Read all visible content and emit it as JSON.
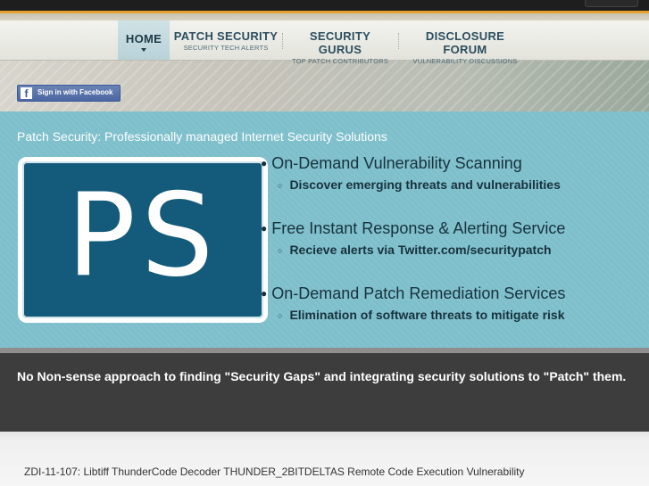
{
  "nav": {
    "home": {
      "label": "HOME"
    },
    "items": [
      {
        "label": "PATCH SECURITY",
        "sub": "SECURITY TECH ALERTS"
      },
      {
        "label": "SECURITY GURUS",
        "sub": "TOP PATCH CONTRIBUTORS"
      },
      {
        "label": "DISCLOSURE FORUM",
        "sub": "VULNERABILITY DISCUSSIONS"
      }
    ]
  },
  "facebook": {
    "label": "Sign in with Facebook",
    "icon": "facebook-f-icon"
  },
  "hero": {
    "title": "Patch Security: Professionally managed Internet Security Solutions",
    "logo_text": "PS",
    "features": [
      {
        "title": "On-Demand Vulnerability Scanning",
        "sub": "Discover emerging threats and vulnerabilities"
      },
      {
        "title": "Free Instant Response & Alerting Service",
        "sub": "Recieve alerts via Twitter.com/securitypatch"
      },
      {
        "title": "On-Demand Patch Remediation Services",
        "sub": "Elimination of software threats to mitigate risk"
      }
    ]
  },
  "tagline": "No Non-sense approach to finding \"Security Gaps\" and integrating security solutions to \"Patch\" them.",
  "news": {
    "headline": "ZDI-11-107: Libtiff ThunderCode Decoder THUNDER_2BITDELTAS Remote Code Execution Vulnerability"
  },
  "colors": {
    "accent": "#e6a02d",
    "panel": "#7dbfcb",
    "logo_bg": "#145b7b",
    "band": "#3d3d3d",
    "facebook": "#3b5998"
  }
}
